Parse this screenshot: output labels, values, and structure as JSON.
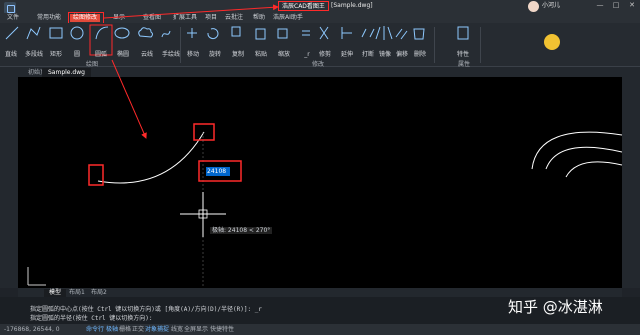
{
  "window": {
    "app_title": "浩辰CAD看图王",
    "doc_title": "[Sample.dwg]",
    "user_name": "小河儿",
    "controls": [
      "—",
      "□",
      "✕"
    ]
  },
  "menu": {
    "items": [
      "文件",
      "常用功能",
      "绘图修改",
      "显示",
      "查看图",
      "扩展工具",
      "项目",
      "云批注",
      "帮助",
      "浩辰AI助手"
    ],
    "active_index": 2
  },
  "ribbon": {
    "tools": [
      {
        "label": "直线",
        "icon": "line-icon"
      },
      {
        "label": "多段线",
        "icon": "polyline-icon"
      },
      {
        "label": "矩形",
        "icon": "rectangle-icon"
      },
      {
        "label": "圆",
        "icon": "circle-icon"
      },
      {
        "label": "圆弧",
        "icon": "arc-icon",
        "selected": true
      },
      {
        "label": "椭圆",
        "icon": "ellipse-icon"
      },
      {
        "label": "云线",
        "icon": "cloud-icon"
      },
      {
        "label": "手绘线",
        "icon": "freehand-icon"
      },
      {
        "label": "移动",
        "icon": "move-icon"
      },
      {
        "label": "旋转",
        "icon": "rotate-icon"
      },
      {
        "label": "复制",
        "icon": "copy-icon"
      },
      {
        "label": "粘贴",
        "icon": "paste-icon"
      },
      {
        "label": "缩放",
        "icon": "scale-icon"
      },
      {
        "label": "_r",
        "icon": "other-icon"
      },
      {
        "label": "修剪",
        "icon": "trim-icon"
      },
      {
        "label": "延伸",
        "icon": "extend-icon"
      },
      {
        "label": "打断",
        "icon": "break-icon"
      },
      {
        "label": "镜像",
        "icon": "mirror-icon"
      },
      {
        "label": "偏移",
        "icon": "offset-icon"
      },
      {
        "label": "删除",
        "icon": "delete-icon"
      },
      {
        "label": "特性",
        "icon": "properties-icon"
      }
    ],
    "groups": [
      "绘图",
      "修改",
      "属性"
    ]
  },
  "doc_tabs": [
    "初始页",
    "Sample.dwg"
  ],
  "canvas": {
    "input_value": "24108",
    "tooltip": "极轴: 24108 < 270°"
  },
  "layout_tabs": [
    "模型",
    "布局1",
    "布局2"
  ],
  "command": {
    "line1": "指定圆弧的中心点(按住 Ctrl 键以切换方向)或 [角度(A)/方向(D)/半径(R)]: _r",
    "line2": "指定圆弧的半径(按住 Ctrl 键以切换方向):"
  },
  "status": {
    "coords": "-176868, 26544, 0",
    "items": [
      {
        "label": "命令行",
        "on": true
      },
      {
        "label": "极轴",
        "on": true
      },
      {
        "label": "栅格",
        "on": false
      },
      {
        "label": "正交",
        "on": false
      },
      {
        "label": "对象捕捉",
        "on": true
      },
      {
        "label": "线宽",
        "on": false
      },
      {
        "label": "全屏显示",
        "on": false
      },
      {
        "label": "快捷特性",
        "on": false
      }
    ]
  },
  "watermark": "知乎 @冰湛淋",
  "colors": {
    "highlight_box": "#ff2a2a",
    "active_menu": "#e24a3a",
    "canvas_bg": "#000000"
  }
}
